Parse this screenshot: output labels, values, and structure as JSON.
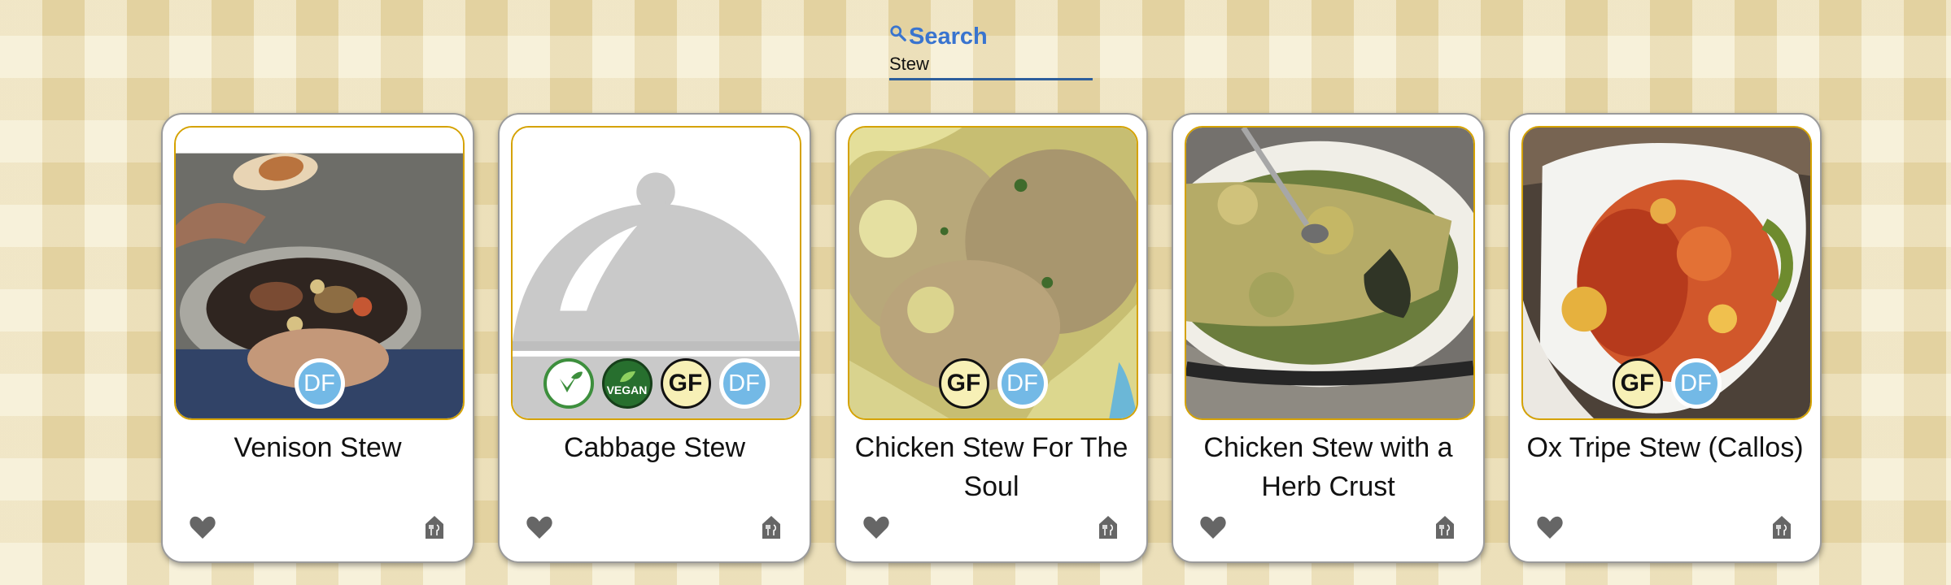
{
  "search": {
    "label": "Search",
    "value": "Stew",
    "icon": "search-icon",
    "accent_color": "#3974cf"
  },
  "cards": [
    {
      "title": "Venison Stew",
      "image": "venison-stew-photo",
      "badges": [
        {
          "label": "DF",
          "meaning": "dairy-free"
        }
      ]
    },
    {
      "title": "Cabbage Stew",
      "image": "placeholder-cloche-icon",
      "badges": [
        {
          "label": "VEGETARIAN FRIENDLY",
          "meaning": "vegetarian"
        },
        {
          "label": "VEGAN",
          "meaning": "vegan"
        },
        {
          "label": "GF",
          "meaning": "gluten-free"
        },
        {
          "label": "DF",
          "meaning": "dairy-free"
        }
      ]
    },
    {
      "title": "Chicken Stew For The Soul",
      "image": "chicken-stew-photo",
      "badges": [
        {
          "label": "GF",
          "meaning": "gluten-free"
        },
        {
          "label": "DF",
          "meaning": "dairy-free"
        }
      ]
    },
    {
      "title": "Chicken Stew with a Herb Crust",
      "image": "herb-crust-stew-photo",
      "badges": []
    },
    {
      "title": "Ox Tripe Stew (Callos)",
      "image": "ox-tripe-stew-photo",
      "badges": [
        {
          "label": "GF",
          "meaning": "gluten-free"
        },
        {
          "label": "DF",
          "meaning": "dairy-free"
        }
      ]
    }
  ],
  "icons": {
    "favorite": "heart-icon",
    "meal_plan": "meal-plan-icon"
  }
}
